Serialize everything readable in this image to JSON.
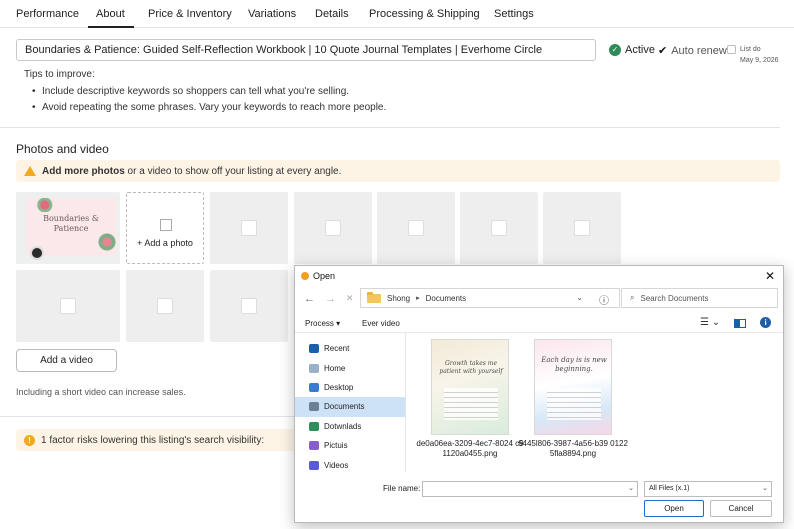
{
  "tabs": [
    {
      "label": "Performance"
    },
    {
      "label": "About"
    },
    {
      "label": "Price & Inventory"
    },
    {
      "label": "Variations"
    },
    {
      "label": "Details"
    },
    {
      "label": "Processing & Shipping"
    },
    {
      "label": "Settings"
    }
  ],
  "listing": {
    "title": "Boundaries & Patience: Guided Self-Reflection Workbook | 10 Quote Journal Templates | Everhome Circle",
    "status": "Active",
    "auto_renew": "Auto renew",
    "list_do": "List do",
    "list_date": "May 9, 2026"
  },
  "tips": {
    "heading": "Tips to improve:",
    "items": [
      "Include descriptive keywords so shoppers can tell what you're selling.",
      "Avoid repeating the some phrases. Vary your keywords to reach more people."
    ]
  },
  "photos": {
    "section_title": "Photos and video",
    "banner_bold": "Add more photos",
    "banner_rest": " or a video to show off your listing at every angle.",
    "main_photo_title": "Boundaries & Patience",
    "add_photo_label": "+ Add a photo",
    "add_video_label": "Add a video",
    "video_note": "Including a short video can increase sales."
  },
  "risk": {
    "count_icon": "!",
    "text": "1 factor risks lowering this listing's search visibility:"
  },
  "dialog": {
    "title": "Open",
    "path": [
      "Shong",
      "Documents"
    ],
    "search_placeholder": "Search Documents",
    "process_label": "Process",
    "view_label": "Ever video",
    "sidebar": [
      {
        "label": "Recent",
        "icon": "pin-icon",
        "color": "#1d5ea8"
      },
      {
        "label": "Home",
        "icon": "home-icon",
        "color": "#9ab0c8"
      },
      {
        "label": "Desktop",
        "icon": "desktop-icon",
        "color": "#3b7bd1"
      },
      {
        "label": "Documents",
        "icon": "documents-icon",
        "color": "#6b7f95",
        "active": true
      },
      {
        "label": "Dotwnlads",
        "icon": "downloads-icon",
        "color": "#2f8f5b"
      },
      {
        "label": "Pictuis",
        "icon": "pictures-icon",
        "color": "#8a5dc9"
      },
      {
        "label": "Videos",
        "icon": "videos-icon",
        "color": "#5a5ad6"
      }
    ],
    "files": [
      {
        "name": "de0a06ea-3209-4ec7-8024 c91120a0455.png",
        "thumb_text": "Growth takes me patient with yourself"
      },
      {
        "name": "6445l806-3987-4a56-b39 01225fla8894.png",
        "thumb_text": "Each day is is new beginning."
      }
    ],
    "file_name_label": "File name:",
    "file_name_value": "",
    "filter": "All Files (x.1)",
    "open_label": "Open",
    "cancel_label": "Cancel"
  },
  "colors": {
    "accent_green": "#2e8b57",
    "warning": "#f2a91d",
    "banner_bg": "#fdf4e6",
    "selection": "#cde2f6",
    "link_blue": "#1d6fc4"
  }
}
